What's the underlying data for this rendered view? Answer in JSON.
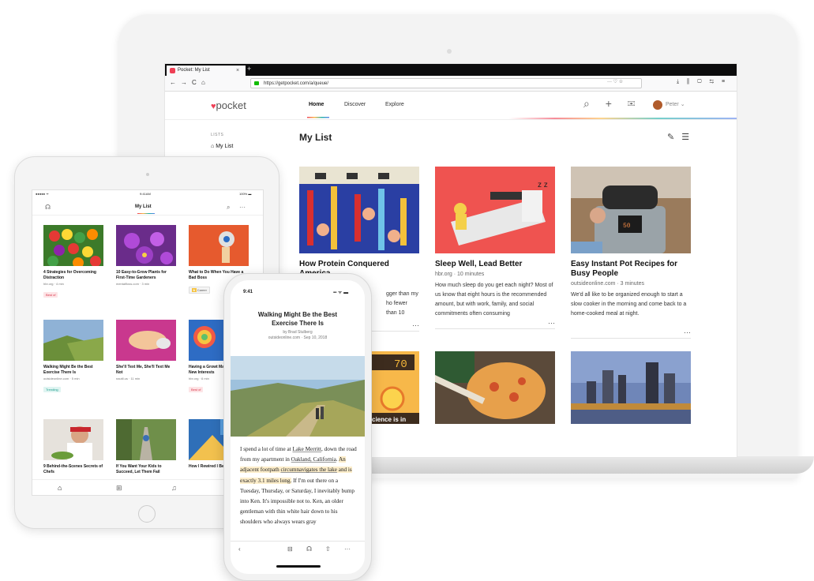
{
  "browser": {
    "tab_title": "Pocket: My List",
    "tab_close": "×",
    "new_tab": "+",
    "url": "https://getpocket.com/a/queue/",
    "url_actions": "··· ♡ ☆",
    "nav_back": "←",
    "nav_forward": "→",
    "nav_reload": "C",
    "nav_home": "⌂",
    "toolbar_icons": "⤓ ⫼ ▢ ⇆ ≡"
  },
  "app": {
    "logo_mark": "♥",
    "logo_text": "pocket",
    "nav": {
      "home": "Home",
      "discover": "Discover",
      "explore": "Explore"
    },
    "header_icons": "⌕ + ✉",
    "user_name": "Peter",
    "user_caret": "⌄",
    "sidebar": {
      "section": "LISTS",
      "my_list": "My List"
    },
    "page_title": "My List",
    "page_tools": "✎ ☰",
    "more": "···",
    "cards": [
      {
        "title": "How Protein Conquered America",
        "meta": "",
        "excerpt": "gger than my ho fewer than 10"
      },
      {
        "title": "Sleep Well, Lead Better",
        "meta": "hbr.org · 10 minutes",
        "excerpt": "How much sleep do you get each night? Most of us know that eight hours is the recommended amount, but with work, family, and social commitments often consuming"
      },
      {
        "title": "Easy Instant Pot Recipes for Busy People",
        "meta": "outsideonline.com · 3 minutes",
        "excerpt": "We'd all like to be organized enough to start a slow cooker in the morning and come back to a home-cooked meal at night."
      }
    ],
    "row2_text": "cience is in",
    "row2_score": "70"
  },
  "tablet": {
    "status_left": "●●●●● ᯤ",
    "status_time": "9:41AM",
    "status_right": "100% ▬",
    "title": "My List",
    "icon_listen": "☊",
    "icon_search": "⌕",
    "icon_more": "···",
    "cards": [
      {
        "title": "4 Strategies for Overcoming Distraction",
        "meta": "hbr.org · 4 min",
        "badge": "Best of"
      },
      {
        "title": "10 Easy-to-Grow Plants for First-Time Gardeners",
        "meta": "mentalfloss.com · 3 min",
        "badge": ""
      },
      {
        "title": "What to Do When You Have a Bad Boss",
        "meta": "",
        "badge": "Career"
      },
      {
        "title": "Walking Might Be the Best Exercise There Is",
        "meta": "outsideonline.com · 5 min",
        "badge": "Trending"
      },
      {
        "title": "She'll Text Me, She'll Text Me Not",
        "meta": "nautil.us · 11 min",
        "badge": ""
      },
      {
        "title": "Having a Growt Makes It Easies New Interests",
        "meta": "hbr.org · 6 min",
        "badge": "Best of"
      },
      {
        "title": "9 Behind-the-Scenes Secrets of Chefs",
        "meta": "",
        "badge": ""
      },
      {
        "title": "If You Want Your Kids to Succeed, Let Them Fail",
        "meta": "",
        "badge": ""
      },
      {
        "title": "How I Rewired I Become Fluent",
        "meta": "",
        "badge": ""
      }
    ],
    "footer": {
      "home": "⌂",
      "save": "⊞",
      "bell": "♫"
    }
  },
  "phone": {
    "time": "9:41",
    "signal": "▪▪ ᯤ ▬",
    "title": "Walking Might Be the Best Exercise There Is",
    "byline": "by Brad Stulberg",
    "source": "outsideonline.com · Sep 10, 2018",
    "body": {
      "p1": "I spend a lot of time at ",
      "l1": "Lake Merritt",
      "p2": ", down the road from my apartment in ",
      "l2": "Oakland, California",
      "p3": ". ",
      "hl1": "An adjacent footpath ",
      "hl2": "circumnavigates the lake",
      "hl3": " and is exactly 3.1 miles long.",
      "p4": " If I'm out there on a Tuesday, Thursday, or Saturday, I inevitably bump into Ken. It's impossible not to. Ken, an older gentleman with thin white hair down to his shoulders who always wears gray"
    },
    "toolbar": {
      "back": "‹",
      "archive": "⊟",
      "listen": "☊",
      "share": "⇧",
      "more": "···"
    }
  }
}
